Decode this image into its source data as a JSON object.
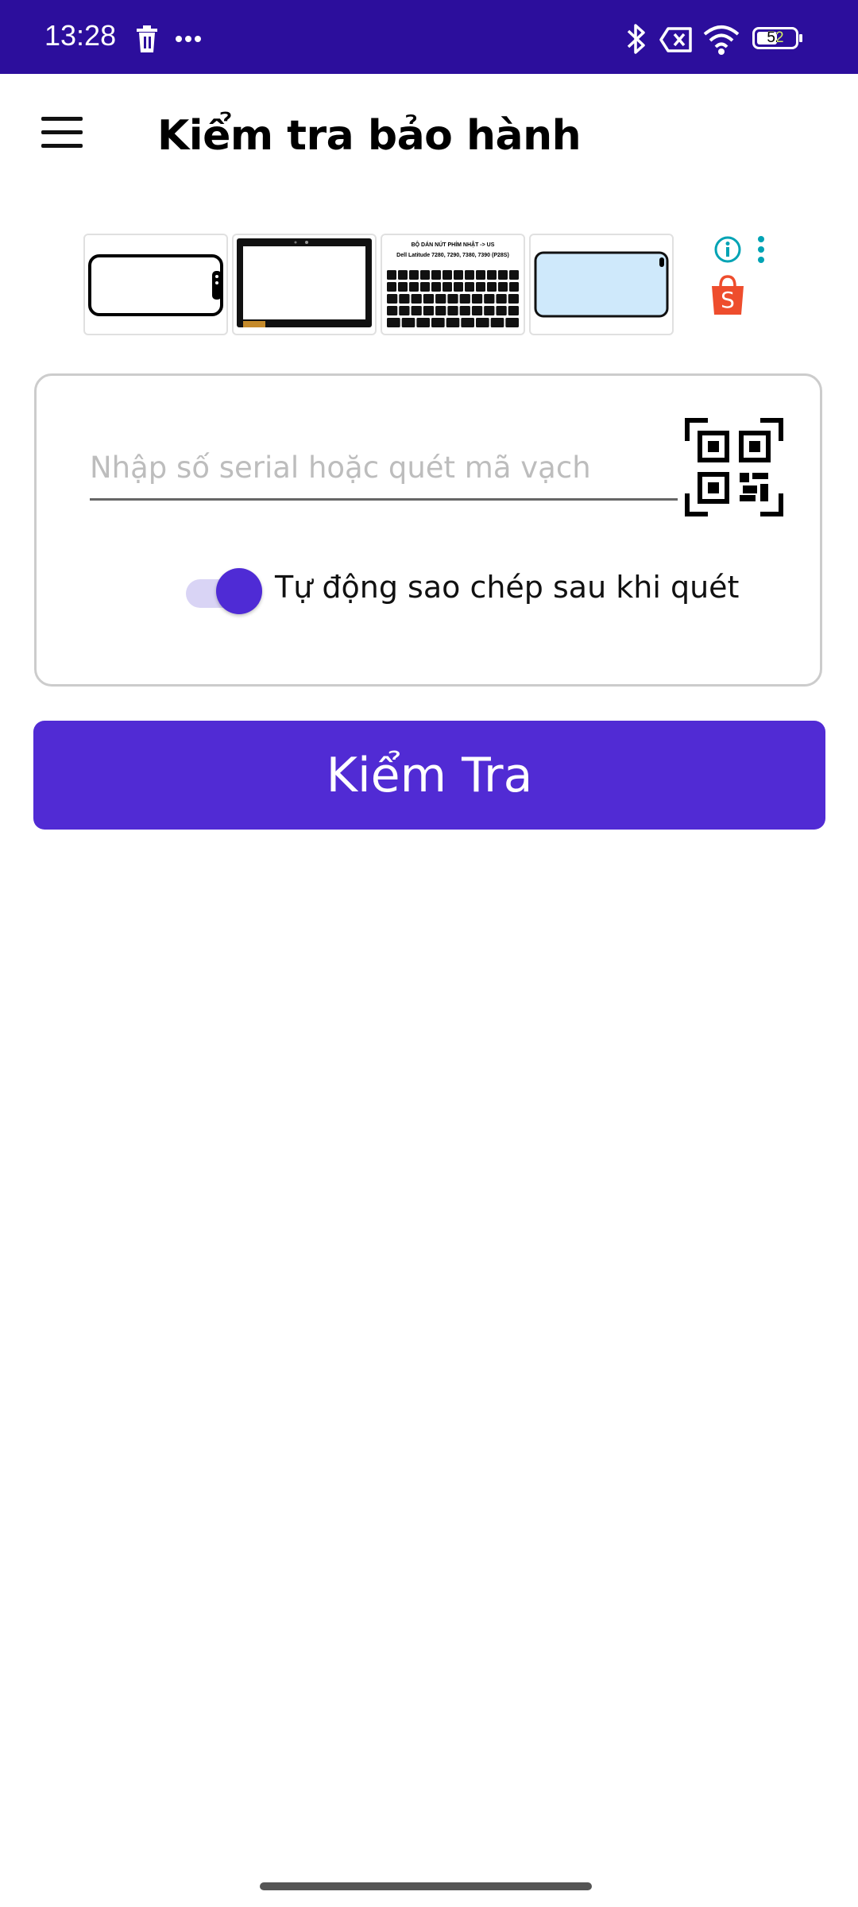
{
  "status_bar": {
    "time": "13:28",
    "battery": "52",
    "background": "#2c0e9c",
    "icons": [
      "delete-icon",
      "more-horizontal-icon",
      "bluetooth-icon",
      "no-sim-icon",
      "wifi-icon",
      "battery-icon"
    ]
  },
  "app_bar": {
    "title": "Kiểm tra bảo hành",
    "menu_icon": "hamburger-menu-icon"
  },
  "ad": {
    "keyboard_title": "BỘ DÁN NÚT PHÍM NHẬT -> US",
    "keyboard_models": "Dell Latitude 7280, 7290, 7380, 7390 (P28S)",
    "icons": [
      "ad-info-icon",
      "ad-more-icon",
      "shopee-icon"
    ],
    "shopee_letter": "S"
  },
  "form": {
    "serial_placeholder": "Nhập số serial hoặc quét mã vạch",
    "serial_value": "",
    "auto_copy_label": "Tự động sao chép sau khi quét",
    "auto_copy_enabled": true
  },
  "actions": {
    "check_label": "Kiểm Tra"
  },
  "colors": {
    "accent": "#512bd4",
    "status_bar": "#2c0e9c",
    "toggle_track": "#d9d4f5",
    "shopee": "#ee4d2d",
    "ad_icon": "#00a3b4"
  }
}
